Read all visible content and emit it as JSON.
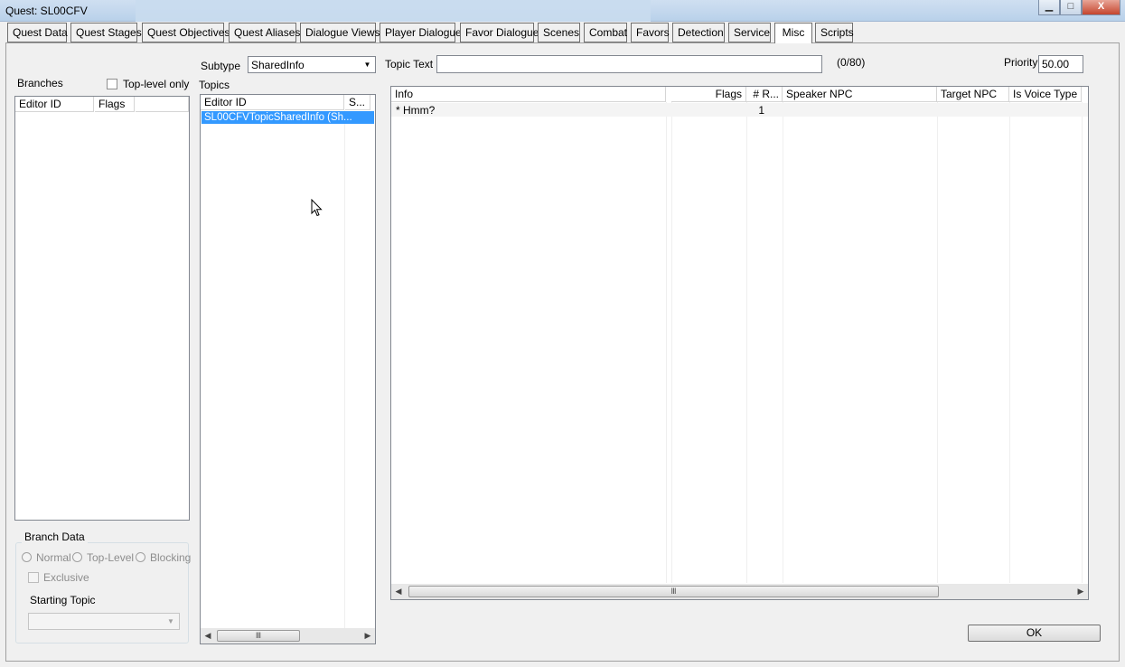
{
  "window": {
    "title": "Quest: SL00CFV",
    "controls": {
      "minimize": "▁",
      "maximize": "□",
      "close": "X"
    }
  },
  "tabs": [
    "Quest Data",
    "Quest Stages",
    "Quest Objectives",
    "Quest Aliases",
    "Dialogue Views",
    "Player Dialogue",
    "Favor Dialogue",
    "Scenes",
    "Combat",
    "Favors",
    "Detection",
    "Service",
    "Misc",
    "Scripts"
  ],
  "active_tab": "Misc",
  "branches": {
    "label": "Branches",
    "top_level_only": "Top-level only",
    "columns": [
      "Editor ID",
      "Flags"
    ]
  },
  "branch_data": {
    "group_label": "Branch Data",
    "radios": [
      "Normal",
      "Top-Level",
      "Blocking"
    ],
    "exclusive": "Exclusive",
    "starting_topic": "Starting Topic"
  },
  "topics": {
    "subtype_label": "Subtype",
    "subtype_value": "SharedInfo",
    "label": "Topics",
    "columns": [
      "Editor ID",
      "S..."
    ],
    "rows": [
      {
        "editor_id": "SL00CFVTopicSharedInfo (Sh...",
        "s": ""
      }
    ]
  },
  "topic_text": {
    "label": "Topic Text",
    "value": "",
    "counter": "(0/80)"
  },
  "priority": {
    "label": "Priority",
    "value": "50.00"
  },
  "info_table": {
    "columns": [
      "Info",
      "Flags",
      "# R...",
      "Speaker NPC",
      "Target NPC",
      "Is Voice Type"
    ],
    "rows": [
      {
        "info": "* Hmm?",
        "flags": "",
        "responses": "1",
        "speaker": "",
        "target": "",
        "voice": ""
      }
    ]
  },
  "scroll_grip": "Ⅲ",
  "ok_label": "OK"
}
